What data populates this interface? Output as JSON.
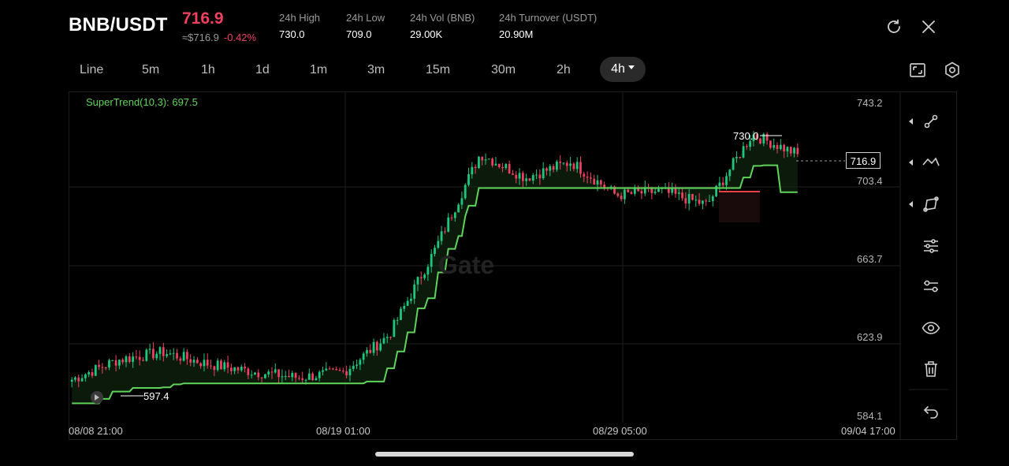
{
  "header": {
    "pair": "BNB/USDT",
    "price": "716.9",
    "usd_price": "≈$716.9",
    "change": "-0.42%",
    "stats": [
      {
        "label": "24h  High",
        "value": "730.0"
      },
      {
        "label": "24h  Low",
        "value": "709.0"
      },
      {
        "label": "24h  Vol (BNB)",
        "value": "29.00K"
      },
      {
        "label": "24h  Turnover (USDT)",
        "value": "20.90M"
      }
    ],
    "refresh_icon": "rotate-icon",
    "close_icon": "close-icon"
  },
  "timeframes": [
    "Line",
    "5m",
    "1h",
    "1d",
    "1m",
    "3m",
    "15m",
    "30m",
    "2h"
  ],
  "active_timeframe": "4h",
  "chart": {
    "indicator": "SuperTrend(10,3): 697.5",
    "watermark": "Gate",
    "y_labels": [
      "743.2",
      "703.4",
      "663.7",
      "623.9",
      "584.1"
    ],
    "x_labels": [
      "08/08 21:00",
      "08/19 01:00",
      "08/29 05:00",
      "09/04 17:00"
    ],
    "high_marker": "730.0",
    "low_marker": "597.4",
    "current_price": "716.9"
  },
  "colors": {
    "up": "#1fc77e",
    "down": "#f0405f",
    "supertrend": "#5fd45a",
    "background": "#000000"
  },
  "chart_data": {
    "type": "candlestick",
    "symbol": "BNB/USDT",
    "interval": "4h",
    "ylim": [
      584.1,
      743.2
    ],
    "close_series": [
      {
        "x": "08/08 21:00",
        "close": 602
      },
      {
        "x": "08/10",
        "close": 612
      },
      {
        "x": "08/12",
        "close": 616
      },
      {
        "x": "08/14",
        "close": 610
      },
      {
        "x": "08/16",
        "close": 606
      },
      {
        "x": "08/18",
        "close": 603
      },
      {
        "x": "08/19 01:00",
        "close": 606
      },
      {
        "x": "08/20",
        "close": 625
      },
      {
        "x": "08/22",
        "close": 668
      },
      {
        "x": "08/23",
        "close": 717
      },
      {
        "x": "08/25",
        "close": 705
      },
      {
        "x": "08/27",
        "close": 713
      },
      {
        "x": "08/29 05:00",
        "close": 696
      },
      {
        "x": "08/31",
        "close": 698
      },
      {
        "x": "09/02",
        "close": 691
      },
      {
        "x": "09/03",
        "close": 727
      },
      {
        "x": "09/04 17:00",
        "close": 716.9
      }
    ],
    "supertrend": {
      "name": "SuperTrend(10,3)",
      "last": 697.5
    },
    "high": 730.0,
    "low": 597.4,
    "last": 716.9
  }
}
